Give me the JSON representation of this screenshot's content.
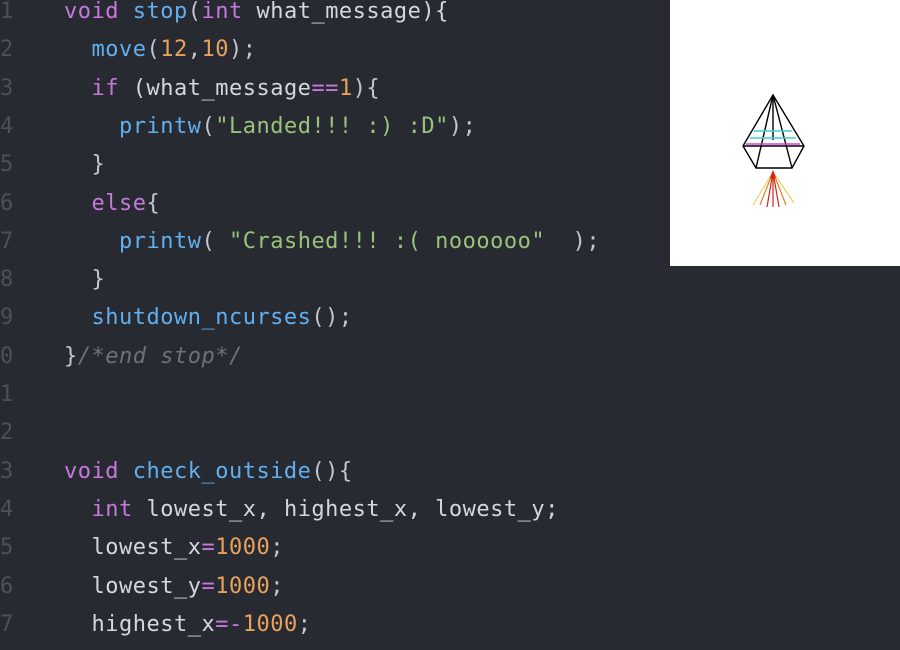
{
  "editor": {
    "lines": [
      {
        "num": "1",
        "tokens": [
          {
            "t": "void",
            "c": "kw"
          },
          {
            "t": " ",
            "c": "id"
          },
          {
            "t": "stop",
            "c": "fn"
          },
          {
            "t": "(",
            "c": "pn"
          },
          {
            "t": "int",
            "c": "kw"
          },
          {
            "t": " what_message){",
            "c": "id"
          }
        ]
      },
      {
        "num": "2",
        "tokens": [
          {
            "t": "  ",
            "c": "id"
          },
          {
            "t": "move",
            "c": "fn"
          },
          {
            "t": "(",
            "c": "pn"
          },
          {
            "t": "12",
            "c": "num"
          },
          {
            "t": ",",
            "c": "pn"
          },
          {
            "t": "10",
            "c": "num"
          },
          {
            "t": ");",
            "c": "pn"
          }
        ]
      },
      {
        "num": "3",
        "tokens": [
          {
            "t": "  ",
            "c": "id"
          },
          {
            "t": "if",
            "c": "kw"
          },
          {
            "t": " (what_message",
            "c": "id"
          },
          {
            "t": "==",
            "c": "op"
          },
          {
            "t": "1",
            "c": "num"
          },
          {
            "t": "){",
            "c": "pn"
          }
        ]
      },
      {
        "num": "4",
        "tokens": [
          {
            "t": "    ",
            "c": "id"
          },
          {
            "t": "printw",
            "c": "fn"
          },
          {
            "t": "(",
            "c": "pn"
          },
          {
            "t": "\"Landed!!! :) :D\"",
            "c": "str"
          },
          {
            "t": ");",
            "c": "pn"
          }
        ]
      },
      {
        "num": "5",
        "tokens": [
          {
            "t": "  }",
            "c": "pn"
          }
        ]
      },
      {
        "num": "6",
        "tokens": [
          {
            "t": "  ",
            "c": "id"
          },
          {
            "t": "else",
            "c": "kw"
          },
          {
            "t": "{",
            "c": "pn"
          }
        ]
      },
      {
        "num": "7",
        "tokens": [
          {
            "t": "    ",
            "c": "id"
          },
          {
            "t": "printw",
            "c": "fn"
          },
          {
            "t": "( ",
            "c": "pn"
          },
          {
            "t": "\"Crashed!!! :( noooooo\"",
            "c": "str"
          },
          {
            "t": "  );",
            "c": "pn"
          }
        ]
      },
      {
        "num": "8",
        "tokens": [
          {
            "t": "  }",
            "c": "pn"
          }
        ]
      },
      {
        "num": "9",
        "tokens": [
          {
            "t": "  ",
            "c": "id"
          },
          {
            "t": "shutdown_ncurses",
            "c": "fn"
          },
          {
            "t": "();",
            "c": "pn"
          }
        ]
      },
      {
        "num": "0",
        "tokens": [
          {
            "t": "}",
            "c": "pn"
          },
          {
            "t": "/*end stop*/",
            "c": "cm"
          }
        ]
      },
      {
        "num": "1",
        "tokens": []
      },
      {
        "num": "2",
        "tokens": []
      },
      {
        "num": "3",
        "tokens": [
          {
            "t": "void",
            "c": "kw"
          },
          {
            "t": " ",
            "c": "id"
          },
          {
            "t": "check_outside",
            "c": "fn"
          },
          {
            "t": "(){",
            "c": "pn"
          }
        ]
      },
      {
        "num": "4",
        "tokens": [
          {
            "t": "  ",
            "c": "id"
          },
          {
            "t": "int",
            "c": "kw"
          },
          {
            "t": " lowest_x, highest_x, lowest_y;",
            "c": "id"
          }
        ]
      },
      {
        "num": "5",
        "tokens": [
          {
            "t": "  lowest_x",
            "c": "id"
          },
          {
            "t": "=",
            "c": "op"
          },
          {
            "t": "1000",
            "c": "num"
          },
          {
            "t": ";",
            "c": "pn"
          }
        ]
      },
      {
        "num": "6",
        "tokens": [
          {
            "t": "  lowest_y",
            "c": "id"
          },
          {
            "t": "=",
            "c": "op"
          },
          {
            "t": "1000",
            "c": "num"
          },
          {
            "t": ";",
            "c": "pn"
          }
        ]
      },
      {
        "num": "7",
        "tokens": [
          {
            "t": "  highest_x",
            "c": "id"
          },
          {
            "t": "=-",
            "c": "op"
          },
          {
            "t": "1000",
            "c": "num"
          },
          {
            "t": ";",
            "c": "pn"
          }
        ]
      }
    ]
  },
  "preview": {
    "background": "#ffffff",
    "ship_stroke": "#000000",
    "band_colors": [
      "#3ad0d0",
      "#d040d0"
    ],
    "flame_colors": [
      "#d02020",
      "#e08020",
      "#f0d060"
    ]
  }
}
